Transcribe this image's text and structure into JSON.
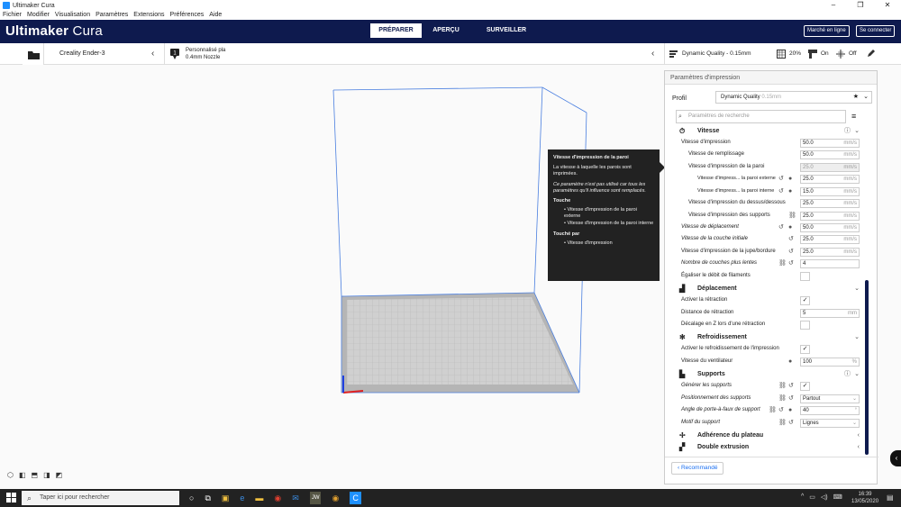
{
  "window": {
    "title": "Ultimaker Cura",
    "minimize": "–",
    "maximize": "❐",
    "close": "✕"
  },
  "menu": [
    "Fichier",
    "Modifier",
    "Visualisation",
    "Paramètres",
    "Extensions",
    "Préférences",
    "Aide"
  ],
  "header": {
    "brand_bold": "Ultimaker",
    "brand_light": "Cura",
    "tabs": [
      "PRÉPARER",
      "APERÇU",
      "SURVEILLER"
    ],
    "marketplace": "Marché en ligne",
    "signin": "Se connecter"
  },
  "toolbar": {
    "printer": "Creality Ender-3",
    "material_line1": "Personnalisé pla",
    "material_line2": "0.4mm Nozzle",
    "profile": "Dynamic Quality - 0.15mm",
    "infill": "20%",
    "support": "On",
    "adhesion": "Off"
  },
  "panel": {
    "title": "Paramètres d'impression",
    "profile_label": "Profil",
    "profile_value": "Dynamic Quality",
    "profile_sub": "0.15mm",
    "search_placeholder": "Paramètres de recherche",
    "recommended": "Recommandé",
    "categories": {
      "vitesse": "Vitesse",
      "deplacement": "Déplacement",
      "refroidissement": "Refroidissement",
      "supports": "Supports",
      "adherence": "Adhérence du plateau",
      "double": "Double extrusion"
    },
    "settings": [
      {
        "label": "Vitesse d'impression",
        "value": "50.0",
        "unit": "mm/s"
      },
      {
        "label": "Vitesse de remplissage",
        "value": "50.0",
        "unit": "mm/s"
      },
      {
        "label": "Vitesse d'impression de la paroi",
        "value": "25.0",
        "unit": "mm/s"
      },
      {
        "label": "Vitesse d'impress... la paroi externe",
        "value": "25.0",
        "unit": "mm/s"
      },
      {
        "label": "Vitesse d'impress... la paroi interne",
        "value": "15.0",
        "unit": "mm/s"
      },
      {
        "label": "Vitesse d'impression du dessus/dessous",
        "value": "25.0",
        "unit": "mm/s"
      },
      {
        "label": "Vitesse d'impression des supports",
        "value": "25.0",
        "unit": "mm/s"
      },
      {
        "label": "Vitesse de déplacement",
        "value": "50.0",
        "unit": "mm/s"
      },
      {
        "label": "Vitesse de la couche initiale",
        "value": "25.0",
        "unit": "mm/s"
      },
      {
        "label": "Vitesse d'impression de la jupe/bordure",
        "value": "25.0",
        "unit": "mm/s"
      },
      {
        "label": "Nombre de couches plus lentes",
        "value": "4",
        "unit": ""
      },
      {
        "label": "Égaliser le débit de filaments",
        "value": "",
        "unit": ""
      },
      {
        "label": "Activer la rétraction",
        "value": "✓",
        "unit": ""
      },
      {
        "label": "Distance de rétraction",
        "value": "5",
        "unit": "mm"
      },
      {
        "label": "Décalage en Z lors d'une rétraction",
        "value": "",
        "unit": ""
      },
      {
        "label": "Activer le refroidissement de l'impression",
        "value": "✓",
        "unit": ""
      },
      {
        "label": "Vitesse du ventilateur",
        "value": "100",
        "unit": "%"
      },
      {
        "label": "Générer les supports",
        "value": "✓",
        "unit": ""
      },
      {
        "label": "Positionnement des supports",
        "value": "Partout",
        "unit": ""
      },
      {
        "label": "Angle de porte-à-faux de support",
        "value": "40",
        "unit": "°"
      },
      {
        "label": "Motif du support",
        "value": "Lignes",
        "unit": ""
      }
    ]
  },
  "tooltip": {
    "title": "Vitesse d'impression de la paroi",
    "desc": "La vitesse à laquelle les parois sont imprimées.",
    "note": "Ce paramètre n'est pas utilisé car tous les paramètres qu'il influence sont remplacés.",
    "affects_title": "Touche",
    "affects": [
      "Vitesse d'impression de la paroi externe",
      "Vitesse d'impression de la paroi interne"
    ],
    "affected_title": "Touché par",
    "affected": [
      "Vitesse d'impression"
    ]
  },
  "taskbar": {
    "search": "Taper ici pour rechercher",
    "time": "16:39",
    "date": "13/05/2020"
  },
  "colors": {
    "header": "#0e1a4e",
    "accent": "#196ef0"
  }
}
